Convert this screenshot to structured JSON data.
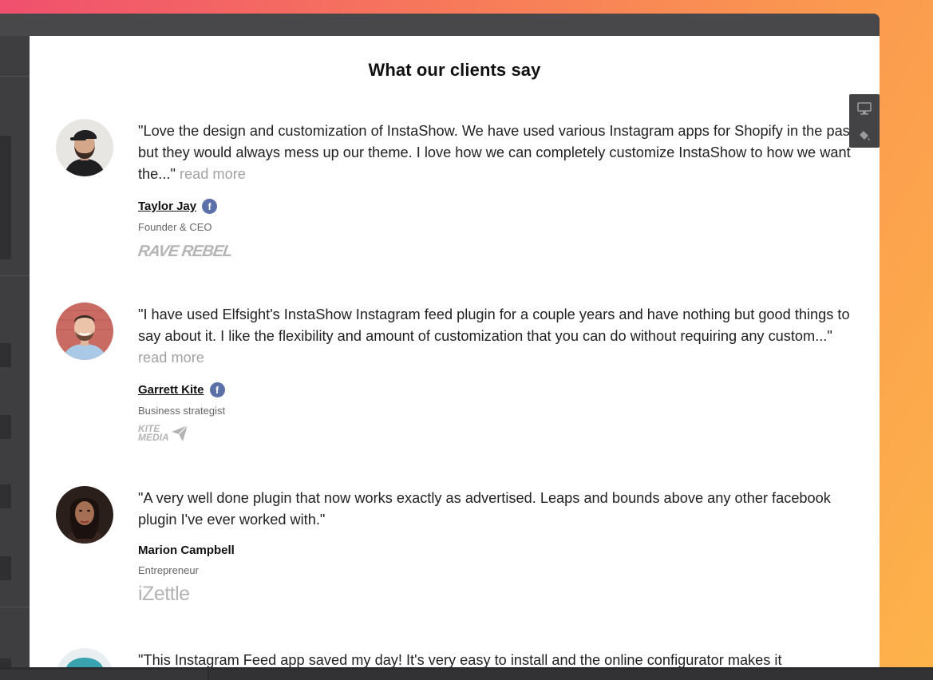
{
  "section": {
    "title": "What our clients say"
  },
  "testimonials": [
    {
      "quote": "\"Love the design and customization of InstaShow. We have used various Instagram apps for Shopify in the past but they would always mess up our theme. I love how we can completely customize InstaShow to how we want the...\"",
      "read_more": "read more",
      "author": "Taylor Jay",
      "role": "Founder & CEO",
      "company_logo": "RAVE REBEL",
      "social_icon": "facebook-icon"
    },
    {
      "quote": "\"I have used Elfsight's InstaShow Instagram feed plugin for a couple years and have nothing but good things to say about it. I like the flexibility and amount of customization that you can do without requiring any custom...\"",
      "read_more": "read more",
      "author": "Garrett Kite",
      "role": "Business strategist",
      "company_logo_line1": "KITE",
      "company_logo_line2": "MEDIA",
      "social_icon": "facebook-icon"
    },
    {
      "quote": "\"A very well done plugin that now works exactly as advertised. Leaps and bounds above any other facebook plugin I've ever worked with.\"",
      "author": "Marion Campbell",
      "role": "Entrepreneur",
      "company_logo": "iZettle"
    },
    {
      "quote": "\"This Instagram Feed app saved my day! It's very easy to install and the online configurator makes it"
    }
  ],
  "social": {
    "facebook_letter": "f"
  },
  "tools": [
    "desktop-icon",
    "paint-bucket-icon"
  ],
  "colors": {
    "accent_facebook": "#5b6fa8",
    "read_more": "#a2a2a2",
    "panel_bg": "#ffffff",
    "chrome_bg": "#3a3a3c"
  }
}
